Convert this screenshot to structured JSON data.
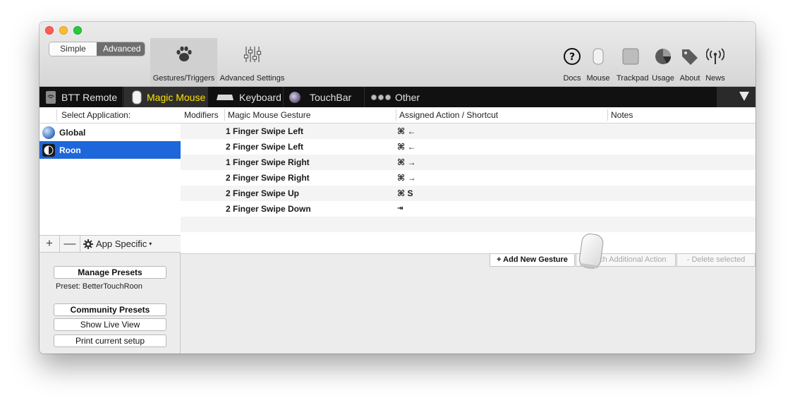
{
  "window": {
    "segmented": {
      "simple": "Simple",
      "advanced": "Advanced"
    },
    "toolbar": {
      "gestures": "Gestures/Triggers",
      "advanced_settings": "Advanced Settings",
      "right_icons": [
        {
          "label": "Docs",
          "icon": "help-circle-icon"
        },
        {
          "label": "Mouse",
          "icon": "magic-mouse-icon"
        },
        {
          "label": "Trackpad",
          "icon": "trackpad-icon"
        },
        {
          "label": "Usage",
          "icon": "pie-chart-icon"
        },
        {
          "label": "About",
          "icon": "tags-icon"
        },
        {
          "label": "News",
          "icon": "broadcast-icon"
        }
      ]
    },
    "tabs": [
      {
        "label": "BTT Remote",
        "icon": "remote-icon"
      },
      {
        "label": "Magic Mouse",
        "icon": "magic-mouse-icon",
        "active": true
      },
      {
        "label": "Keyboard",
        "icon": "keyboard-icon"
      },
      {
        "label": "TouchBar",
        "icon": "touchbar-icon"
      },
      {
        "label": "Other",
        "icon": "dots-icon"
      }
    ],
    "apps": {
      "header": "Select Application:",
      "items": [
        {
          "label": "Global",
          "icon": "globe-icon"
        },
        {
          "label": "Roon",
          "icon": "roon-icon",
          "selected": true
        }
      ],
      "add": "+",
      "remove": "—",
      "app_specific": "App Specific"
    },
    "presets": {
      "manage": "Manage Presets",
      "current": "Preset: BetterTouchRoon",
      "community": "Community Presets",
      "live_view": "Show Live View",
      "print": "Print current setup"
    },
    "table": {
      "headers": {
        "modifiers": "Modifiers",
        "gesture": "Magic Mouse Gesture",
        "action": "Assigned Action / Shortcut",
        "notes": "Notes"
      },
      "rows": [
        {
          "gesture": "1 Finger Swipe Left",
          "action": "⌘ ←"
        },
        {
          "gesture": "2 Finger Swipe Left",
          "action": "⌘ ←"
        },
        {
          "gesture": "1 Finger Swipe Right",
          "action": "⌘ →"
        },
        {
          "gesture": "2 Finger Swipe Right",
          "action": "⌘ →"
        },
        {
          "gesture": "2 Finger Swipe Up",
          "action": "⌘ S"
        },
        {
          "gesture": "2 Finger Swipe Down",
          "action": "⇥"
        }
      ]
    },
    "actions": {
      "add": "+ Add New Gesture",
      "attach": "Attach Additional Action",
      "delete": "- Delete selected"
    },
    "colors": {
      "selection": "#1d67db",
      "active_tab_text": "#ffe300",
      "tabbar_bg": "#111111"
    }
  }
}
